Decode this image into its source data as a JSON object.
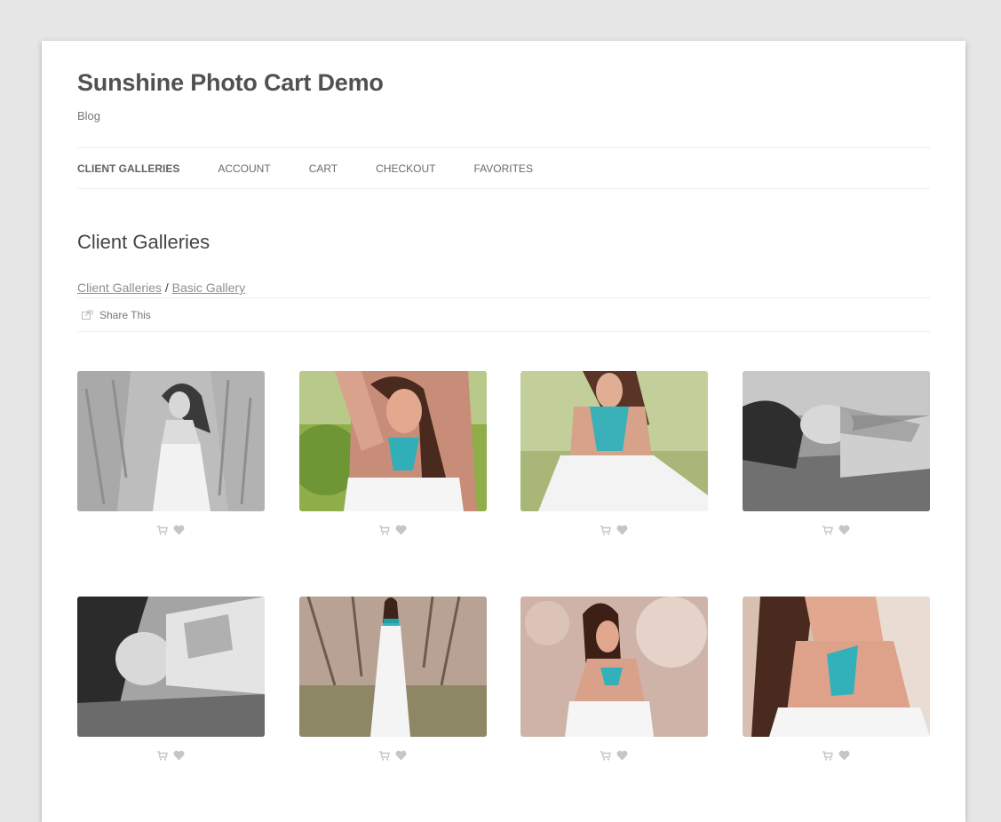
{
  "site": {
    "title": "Sunshine Photo Cart Demo",
    "description": "Blog"
  },
  "nav": {
    "items": [
      {
        "label": "Client Galleries",
        "current": true
      },
      {
        "label": "Account"
      },
      {
        "label": "Cart"
      },
      {
        "label": "Checkout"
      },
      {
        "label": "Favorites"
      }
    ]
  },
  "page": {
    "title": "Client Galleries"
  },
  "breadcrumb": {
    "items": [
      "Client Galleries",
      "Basic Gallery"
    ],
    "separator": "/"
  },
  "share": {
    "label": "Share This",
    "icon": "share-icon"
  },
  "gallery": {
    "action_icons": [
      "cart-icon",
      "heart-icon"
    ],
    "icon_color": "#c6c6c6",
    "photos": [
      {
        "tone": "bw"
      },
      {
        "tone": "color"
      },
      {
        "tone": "color"
      },
      {
        "tone": "bw"
      },
      {
        "tone": "bw"
      },
      {
        "tone": "color"
      },
      {
        "tone": "color"
      },
      {
        "tone": "color"
      }
    ]
  },
  "colors": {
    "background": "#e6e6e6",
    "page": "#ffffff",
    "link": "#8f8f8f",
    "necklace": "#1fb3c0"
  }
}
